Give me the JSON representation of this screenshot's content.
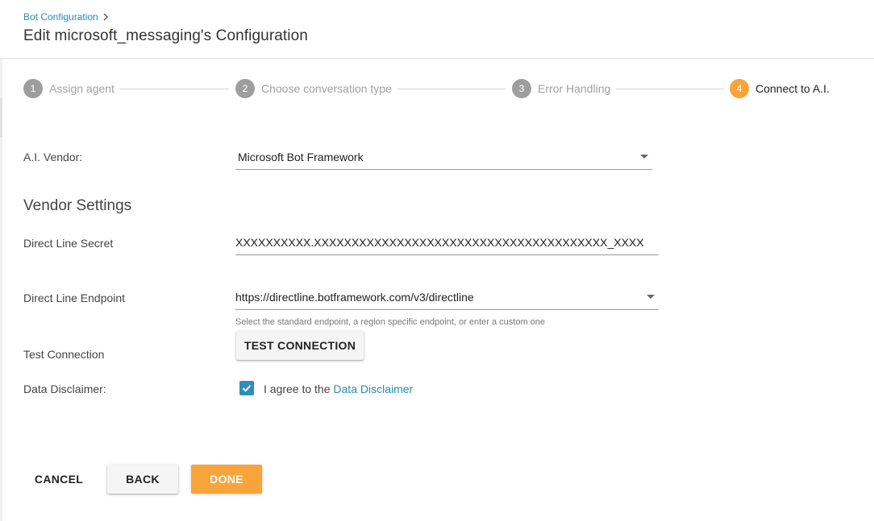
{
  "header": {
    "breadcrumb": "Bot Configuration",
    "title": "Edit microsoft_messaging's Configuration"
  },
  "steps": [
    {
      "number": "1",
      "label": "Assign agent",
      "state": "inactive"
    },
    {
      "number": "2",
      "label": "Choose conversation type",
      "state": "inactive"
    },
    {
      "number": "3",
      "label": "Error Handling",
      "state": "inactive"
    },
    {
      "number": "4",
      "label": "Connect to A.I.",
      "state": "active"
    }
  ],
  "form": {
    "vendor_label": "A.I. Vendor:",
    "vendor_value": "Microsoft Bot Framework",
    "section_title": "Vendor Settings",
    "secret_label": "Direct Line Secret",
    "secret_value": "XXXXXXXXXX.XXXXXXXXXXXXXXXXXXXXXXXXXXXXXXXXXXXXXXX_XXXX",
    "endpoint_label": "Direct Line Endpoint",
    "endpoint_value": "https://directline.botframework.com/v3/directline",
    "endpoint_hint": "Select the standard endpoint, a region specific endpoint, or enter a custom one",
    "test_label": "Test Connection",
    "test_button": "TEST CONNECTION",
    "disclaimer_label": "Data Disclaimer:",
    "agree_prefix": "I agree to the",
    "agree_link": "Data Disclaimer",
    "agree_checked": true
  },
  "footer": {
    "cancel": "CANCEL",
    "back": "BACK",
    "done": "DONE"
  },
  "colors": {
    "accent": "#f9a43a",
    "link": "#2a8ab8",
    "checkbox": "#2e8fb5",
    "step_inactive": "#9e9e9e"
  }
}
